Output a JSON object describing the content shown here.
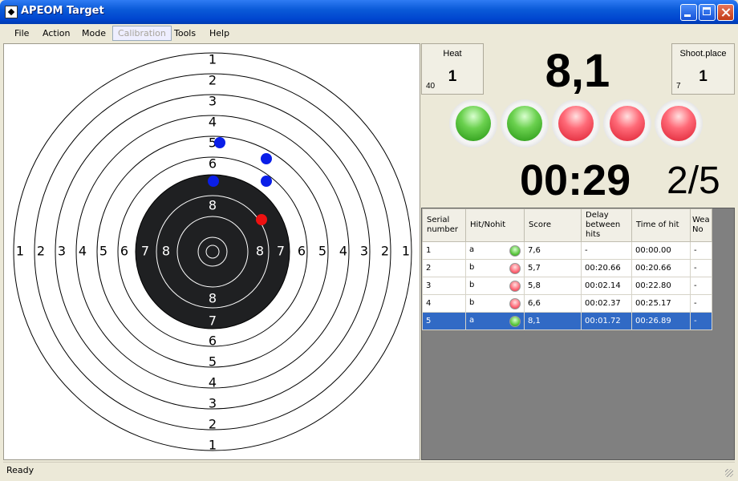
{
  "window": {
    "title": "APEOM Target"
  },
  "menu": [
    "File",
    "Action",
    "Mode",
    "Calibration",
    "Tools",
    "Help"
  ],
  "menu_disabled": "Calibration",
  "target": {
    "ring_numbers_top": [
      "1",
      "2",
      "3",
      "4",
      "5",
      "6"
    ],
    "ring_numbers_bottom": [
      "8",
      "7",
      "6",
      "5",
      "4",
      "3",
      "2",
      "1"
    ],
    "ring_numbers_left": [
      "1",
      "2",
      "3",
      "4",
      "5",
      "6",
      "7",
      "8"
    ],
    "ring_numbers_right": [
      "8",
      "7",
      "6",
      "5",
      "4",
      "3",
      "2",
      "1"
    ],
    "inner_top": "8",
    "shots": [
      {
        "color": "blue"
      },
      {
        "color": "blue"
      },
      {
        "color": "blue"
      },
      {
        "color": "blue"
      },
      {
        "color": "red"
      }
    ]
  },
  "heat": {
    "label": "Heat",
    "value": "1",
    "corner": "40"
  },
  "shoot_place": {
    "label": "Shoot.place",
    "value": "1",
    "corner": "7"
  },
  "current_score": "8,1",
  "indicators": [
    "green",
    "green",
    "red",
    "red",
    "red"
  ],
  "timer": "00:29",
  "shot_counter": "2/5",
  "table": {
    "headers": [
      "Serial number",
      "Hit/Nohit",
      "Score",
      "Delay between hits",
      "Time of hit",
      "Wea No"
    ],
    "rows": [
      {
        "serial": "1",
        "hit": "a",
        "led": "green",
        "score": "7,6",
        "delay": "-",
        "time": "00:00.00",
        "wea": "-"
      },
      {
        "serial": "2",
        "hit": "b",
        "led": "red",
        "score": "5,7",
        "delay": "00:20.66",
        "time": "00:20.66",
        "wea": "-"
      },
      {
        "serial": "3",
        "hit": "b",
        "led": "red",
        "score": "5,8",
        "delay": "00:02.14",
        "time": "00:22.80",
        "wea": "-"
      },
      {
        "serial": "4",
        "hit": "b",
        "led": "red",
        "score": "6,6",
        "delay": "00:02.37",
        "time": "00:25.17",
        "wea": "-"
      },
      {
        "serial": "5",
        "hit": "a",
        "led": "green",
        "score": "8,1",
        "delay": "00:01.72",
        "time": "00:26.89",
        "wea": "-"
      }
    ],
    "selected_row": 4
  },
  "status": "Ready",
  "colors": {
    "selection": "#316ac5",
    "target_black": "#1f2022",
    "shot_blue": "#0a1ee8",
    "shot_red": "#ee1111"
  }
}
